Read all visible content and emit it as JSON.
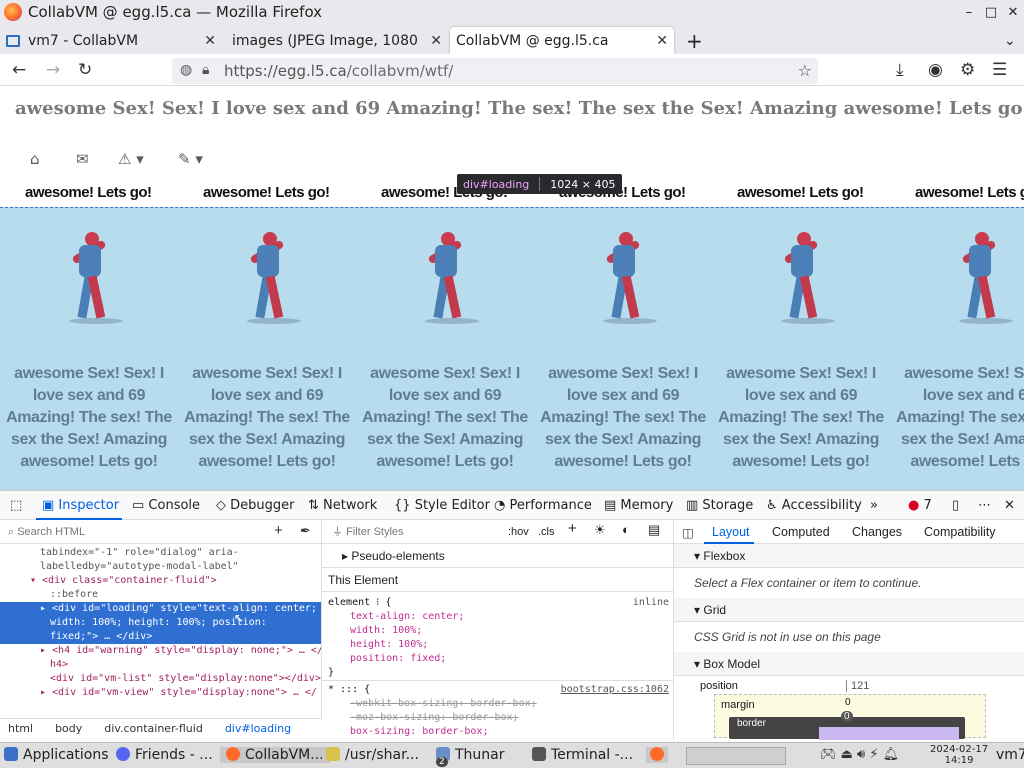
{
  "window": {
    "title": "CollabVM @ egg.l5.ca — Mozilla Firefox",
    "controls": [
      "–",
      "□",
      "✕"
    ]
  },
  "tabs": [
    {
      "label": "vm7 - CollabVM",
      "icon": "monitor-icon"
    },
    {
      "label": "images (JPEG Image, 1080",
      "icon": ""
    },
    {
      "label": "CollabVM @ egg.l5.ca",
      "icon": ""
    }
  ],
  "nav": {
    "url_host": "https://egg.l5.ca",
    "url_path": "/collabvm/wtf/"
  },
  "page": {
    "heading": "awesome Sex! Sex! I love sex and 69 Amazing! The sex! The sex the Sex! Amazing awesome! Lets go!",
    "band_text": "awesome! Lets go!",
    "cell_text": "awesome Sex! Sex! I love sex and 69 Amazing! The sex! The sex the Sex! Amazing awesome! Lets go!"
  },
  "tooltip": {
    "selector": "div#loading",
    "size": "1024 × 405"
  },
  "devtools": {
    "tabs": [
      "Inspector",
      "Console",
      "Debugger",
      "Network",
      "Style Editor",
      "Performance",
      "Memory",
      "Storage",
      "Accessibility"
    ],
    "error_count": "7",
    "search_placeholder": "Search HTML",
    "filter_placeholder": "Filter Styles",
    "hov": ":hov",
    "cls": ".cls",
    "markup_lines": [
      "tabindex=\"-1\" role=\"dialog\" aria-",
      "labelledby=\"autotype-modal-label\"",
      "▾ <div class=\"container-fluid\">",
      "::before",
      "▸ <div id=\"loading\" style=\"text-align: center;",
      "width: 100%; height: 100%; position:",
      "fixed;\"> … </div>",
      "▸ <h4 id=\"warning\" style=\"display: none;\"> … </",
      "h4>",
      "<div id=\"vm-list\" style=\"display:none\"></div>",
      "▸ <div id=\"vm-view\" style=\"display:none\"> … </"
    ],
    "breadcrumbs": [
      "html",
      "body",
      "div.container-fluid",
      "div#loading"
    ],
    "rules": {
      "pseudo": "Pseudo-elements",
      "this_element": "This Element",
      "element_sel": "element",
      "inline": "inline",
      "decls": [
        "text-align: center;",
        "width: 100%;",
        "height: 100%;",
        "position: fixed;"
      ],
      "star_sel": "* ::: {",
      "source": "bootstrap.css:1062",
      "struck1": "-webkit-box-sizing: border-box;",
      "struck2": "-moz-box-sizing: border-box;",
      "boxsizing": "box-sizing: border-box;"
    },
    "layout_tabs": [
      "Layout",
      "Computed",
      "Changes",
      "Compatibility"
    ],
    "flexbox": "Flexbox",
    "flex_msg": "Select a Flex container or item to continue.",
    "grid": "Grid",
    "grid_msg": "CSS Grid is not in use on this page",
    "boxmodel": "Box Model",
    "position_label": "position",
    "position_val": "121",
    "margin_label": "margin",
    "margin_val": "0",
    "border_label": "border",
    "border_val": "0"
  },
  "taskbar": {
    "items": [
      "Applications",
      "Friends - ...",
      "CollabVM...",
      "/usr/shar...",
      "Thunar",
      "Terminal -..."
    ],
    "thunar_count": "2",
    "date": "2024-02-17",
    "time": "14:19",
    "user": "vm7"
  }
}
